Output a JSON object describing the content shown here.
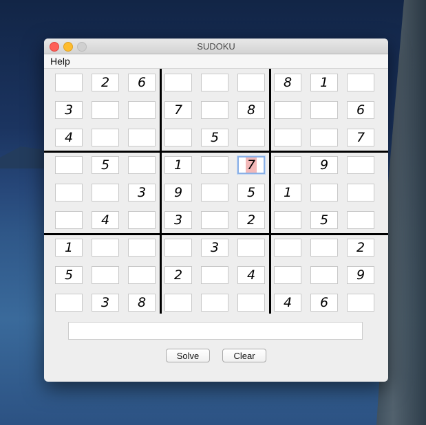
{
  "window": {
    "title": "SUDOKU"
  },
  "menu": [
    {
      "label": "Help"
    }
  ],
  "grid": [
    [
      "",
      "2",
      "6",
      "",
      "",
      "",
      "8",
      "1",
      ""
    ],
    [
      "3",
      "",
      "",
      "7",
      "",
      "8",
      "",
      "",
      "6"
    ],
    [
      "4",
      "",
      "",
      "",
      "5",
      "",
      "",
      "",
      "7"
    ],
    [
      "",
      "5",
      "",
      "1",
      "",
      "7",
      "",
      "9",
      ""
    ],
    [
      "",
      "",
      "3",
      "9",
      "",
      "5",
      "1",
      "",
      ""
    ],
    [
      "",
      "4",
      "",
      "3",
      "",
      "2",
      "",
      "5",
      ""
    ],
    [
      "1",
      "",
      "",
      "",
      "3",
      "",
      "",
      "",
      "2"
    ],
    [
      "5",
      "",
      "",
      "2",
      "",
      "4",
      "",
      "",
      "9"
    ],
    [
      "",
      "3",
      "8",
      "",
      "",
      "",
      "4",
      "6",
      ""
    ]
  ],
  "focused_cell": {
    "row": 3,
    "col": 5
  },
  "status_field": {
    "value": ""
  },
  "buttons": {
    "solve": "Solve",
    "clear": "Clear"
  },
  "colors": {
    "selection_highlight": "#f2b8b8",
    "focus_ring": "#8ab0e6",
    "close_light": "#fe5f57",
    "minimize_light": "#febc2e"
  }
}
